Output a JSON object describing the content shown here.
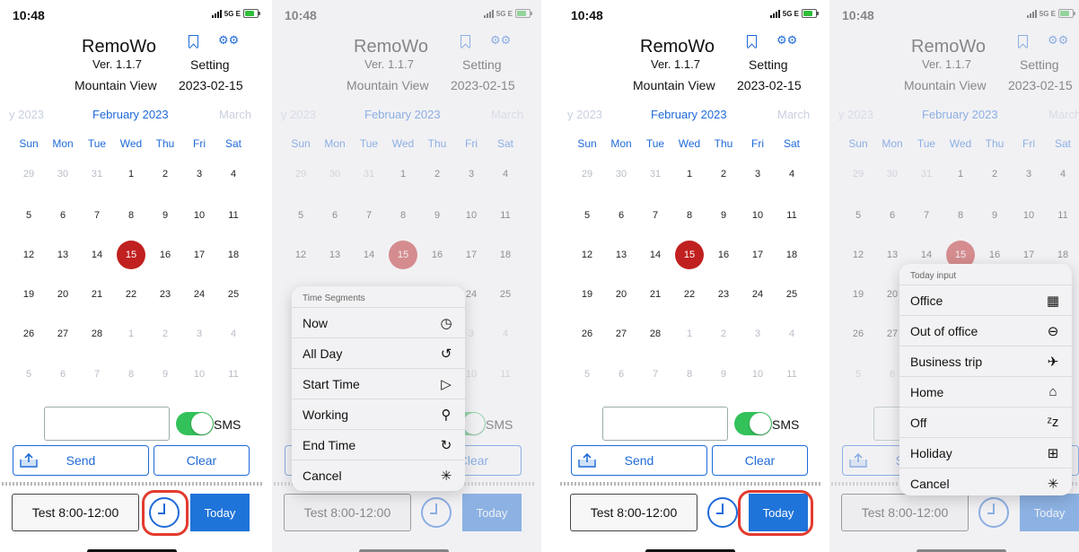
{
  "status": {
    "time": "10:48",
    "network": "5G E"
  },
  "header": {
    "app_name": "RemoWo",
    "version": "Ver. 1.1.7",
    "location": "Mountain View",
    "setting_label": "Setting",
    "date": "2023-02-15"
  },
  "calendar": {
    "prev_month": "y 2023",
    "current_month": "February 2023",
    "next_month": "March",
    "weekdays": [
      "Sun",
      "Mon",
      "Tue",
      "Wed",
      "Thu",
      "Fri",
      "Sat"
    ],
    "weeks": [
      [
        "29",
        "30",
        "31",
        "1",
        "2",
        "3",
        "4"
      ],
      [
        "5",
        "6",
        "7",
        "8",
        "9",
        "10",
        "11"
      ],
      [
        "12",
        "13",
        "14",
        "15",
        "16",
        "17",
        "18"
      ],
      [
        "19",
        "20",
        "21",
        "22",
        "23",
        "24",
        "25"
      ],
      [
        "26",
        "27",
        "28",
        "1",
        "2",
        "3",
        "4"
      ],
      [
        "5",
        "6",
        "7",
        "8",
        "9",
        "10",
        "11"
      ]
    ],
    "selected_day": "15"
  },
  "controls": {
    "sms_label": "SMS",
    "send_label": "Send",
    "clear_label": "Clear",
    "test_label": "Test 8:00-12:00",
    "today_label": "Today"
  },
  "time_segments_menu": {
    "title": "Time Segments",
    "items": [
      {
        "label": "Now",
        "icon": "clock-icon"
      },
      {
        "label": "All Day",
        "icon": "history-icon"
      },
      {
        "label": "Start Time",
        "icon": "play-outline-icon"
      },
      {
        "label": "Working",
        "icon": "walking-person-icon"
      },
      {
        "label": "End Time",
        "icon": "clock-reset-icon"
      },
      {
        "label": "Cancel",
        "icon": "loading-spinner-icon"
      }
    ]
  },
  "today_input_menu": {
    "title": "Today input",
    "items": [
      {
        "label": "Office",
        "icon": "building-icon"
      },
      {
        "label": "Out of office",
        "icon": "minus-circle-icon"
      },
      {
        "label": "Business trip",
        "icon": "airplane-icon"
      },
      {
        "label": "Home",
        "icon": "house-icon"
      },
      {
        "label": "Off",
        "icon": "sleep-zz-icon"
      },
      {
        "label": "Holiday",
        "icon": "gift-icon"
      },
      {
        "label": "Cancel",
        "icon": "loading-spinner-icon"
      }
    ]
  },
  "colors": {
    "accent": "#1f6ad8",
    "today_circle": "#c0201f",
    "toggle_on": "#33c15a",
    "highlight": "#e33b2f"
  }
}
